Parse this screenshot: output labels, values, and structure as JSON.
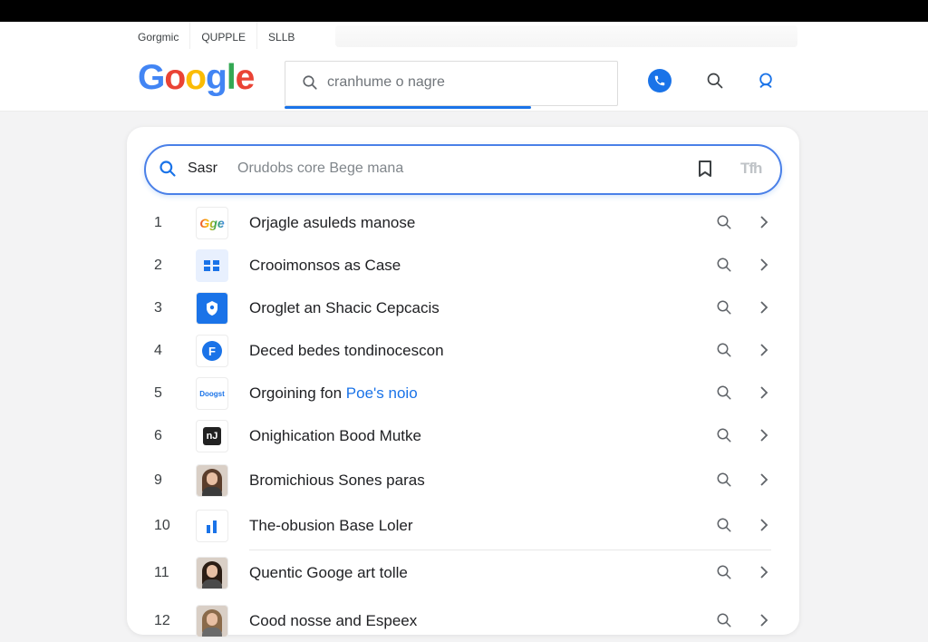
{
  "browser": {
    "tabs": [
      {
        "label": "Gorgmic"
      },
      {
        "label": "QUPPLE"
      },
      {
        "label": "SLLB"
      }
    ]
  },
  "header": {
    "logo_letters": [
      "G",
      "o",
      "o",
      "g",
      "l",
      "e"
    ],
    "logo_colors": [
      "#4285f4",
      "#ea4335",
      "#fbbc05",
      "#4285f4",
      "#34a853",
      "#ea4335"
    ],
    "search_value": "cranhume o nagre",
    "icons": {
      "phone": "phone-icon",
      "search": "search-icon",
      "account": "account-icon"
    }
  },
  "panel": {
    "search": {
      "prefix": "Sasr",
      "query": "Orudobs core Bege mana",
      "tab_hint": "Tfh"
    },
    "results": [
      {
        "num": "1",
        "title": "Orjagle asuleds manose",
        "favicon": "google-g-icon",
        "favicon_text": "Gge"
      },
      {
        "num": "2",
        "title": "Crooimonsos as Case",
        "favicon": "grid-icon"
      },
      {
        "num": "3",
        "title": "Oroglet an Shacic Cepcacis",
        "favicon": "shield-icon"
      },
      {
        "num": "4",
        "title": "Deced bedes tondinocescon",
        "favicon": "letter-f-icon",
        "favicon_text": "F"
      },
      {
        "num": "5",
        "title": "Orgoining fon ",
        "title_highlight": "Poe's noio",
        "favicon": "google-wordmark-icon",
        "favicon_text": "Doogst"
      },
      {
        "num": "6",
        "title": "Onighication Bood Mutke",
        "favicon": "dark-square-icon",
        "favicon_text": "nJ"
      },
      {
        "num": "9",
        "title": "Bromichious Sones paras",
        "favicon": "avatar-icon"
      },
      {
        "num": "10",
        "title": "The-obusion Base Loler",
        "favicon": "bar-chart-icon"
      },
      {
        "num": "11",
        "title": "Quentic Googe art tolle",
        "favicon": "avatar-icon"
      },
      {
        "num": "12",
        "title": "Cood nosse and Espeex",
        "favicon": "avatar-icon"
      }
    ]
  },
  "colors": {
    "accent": "#1a73e8"
  }
}
